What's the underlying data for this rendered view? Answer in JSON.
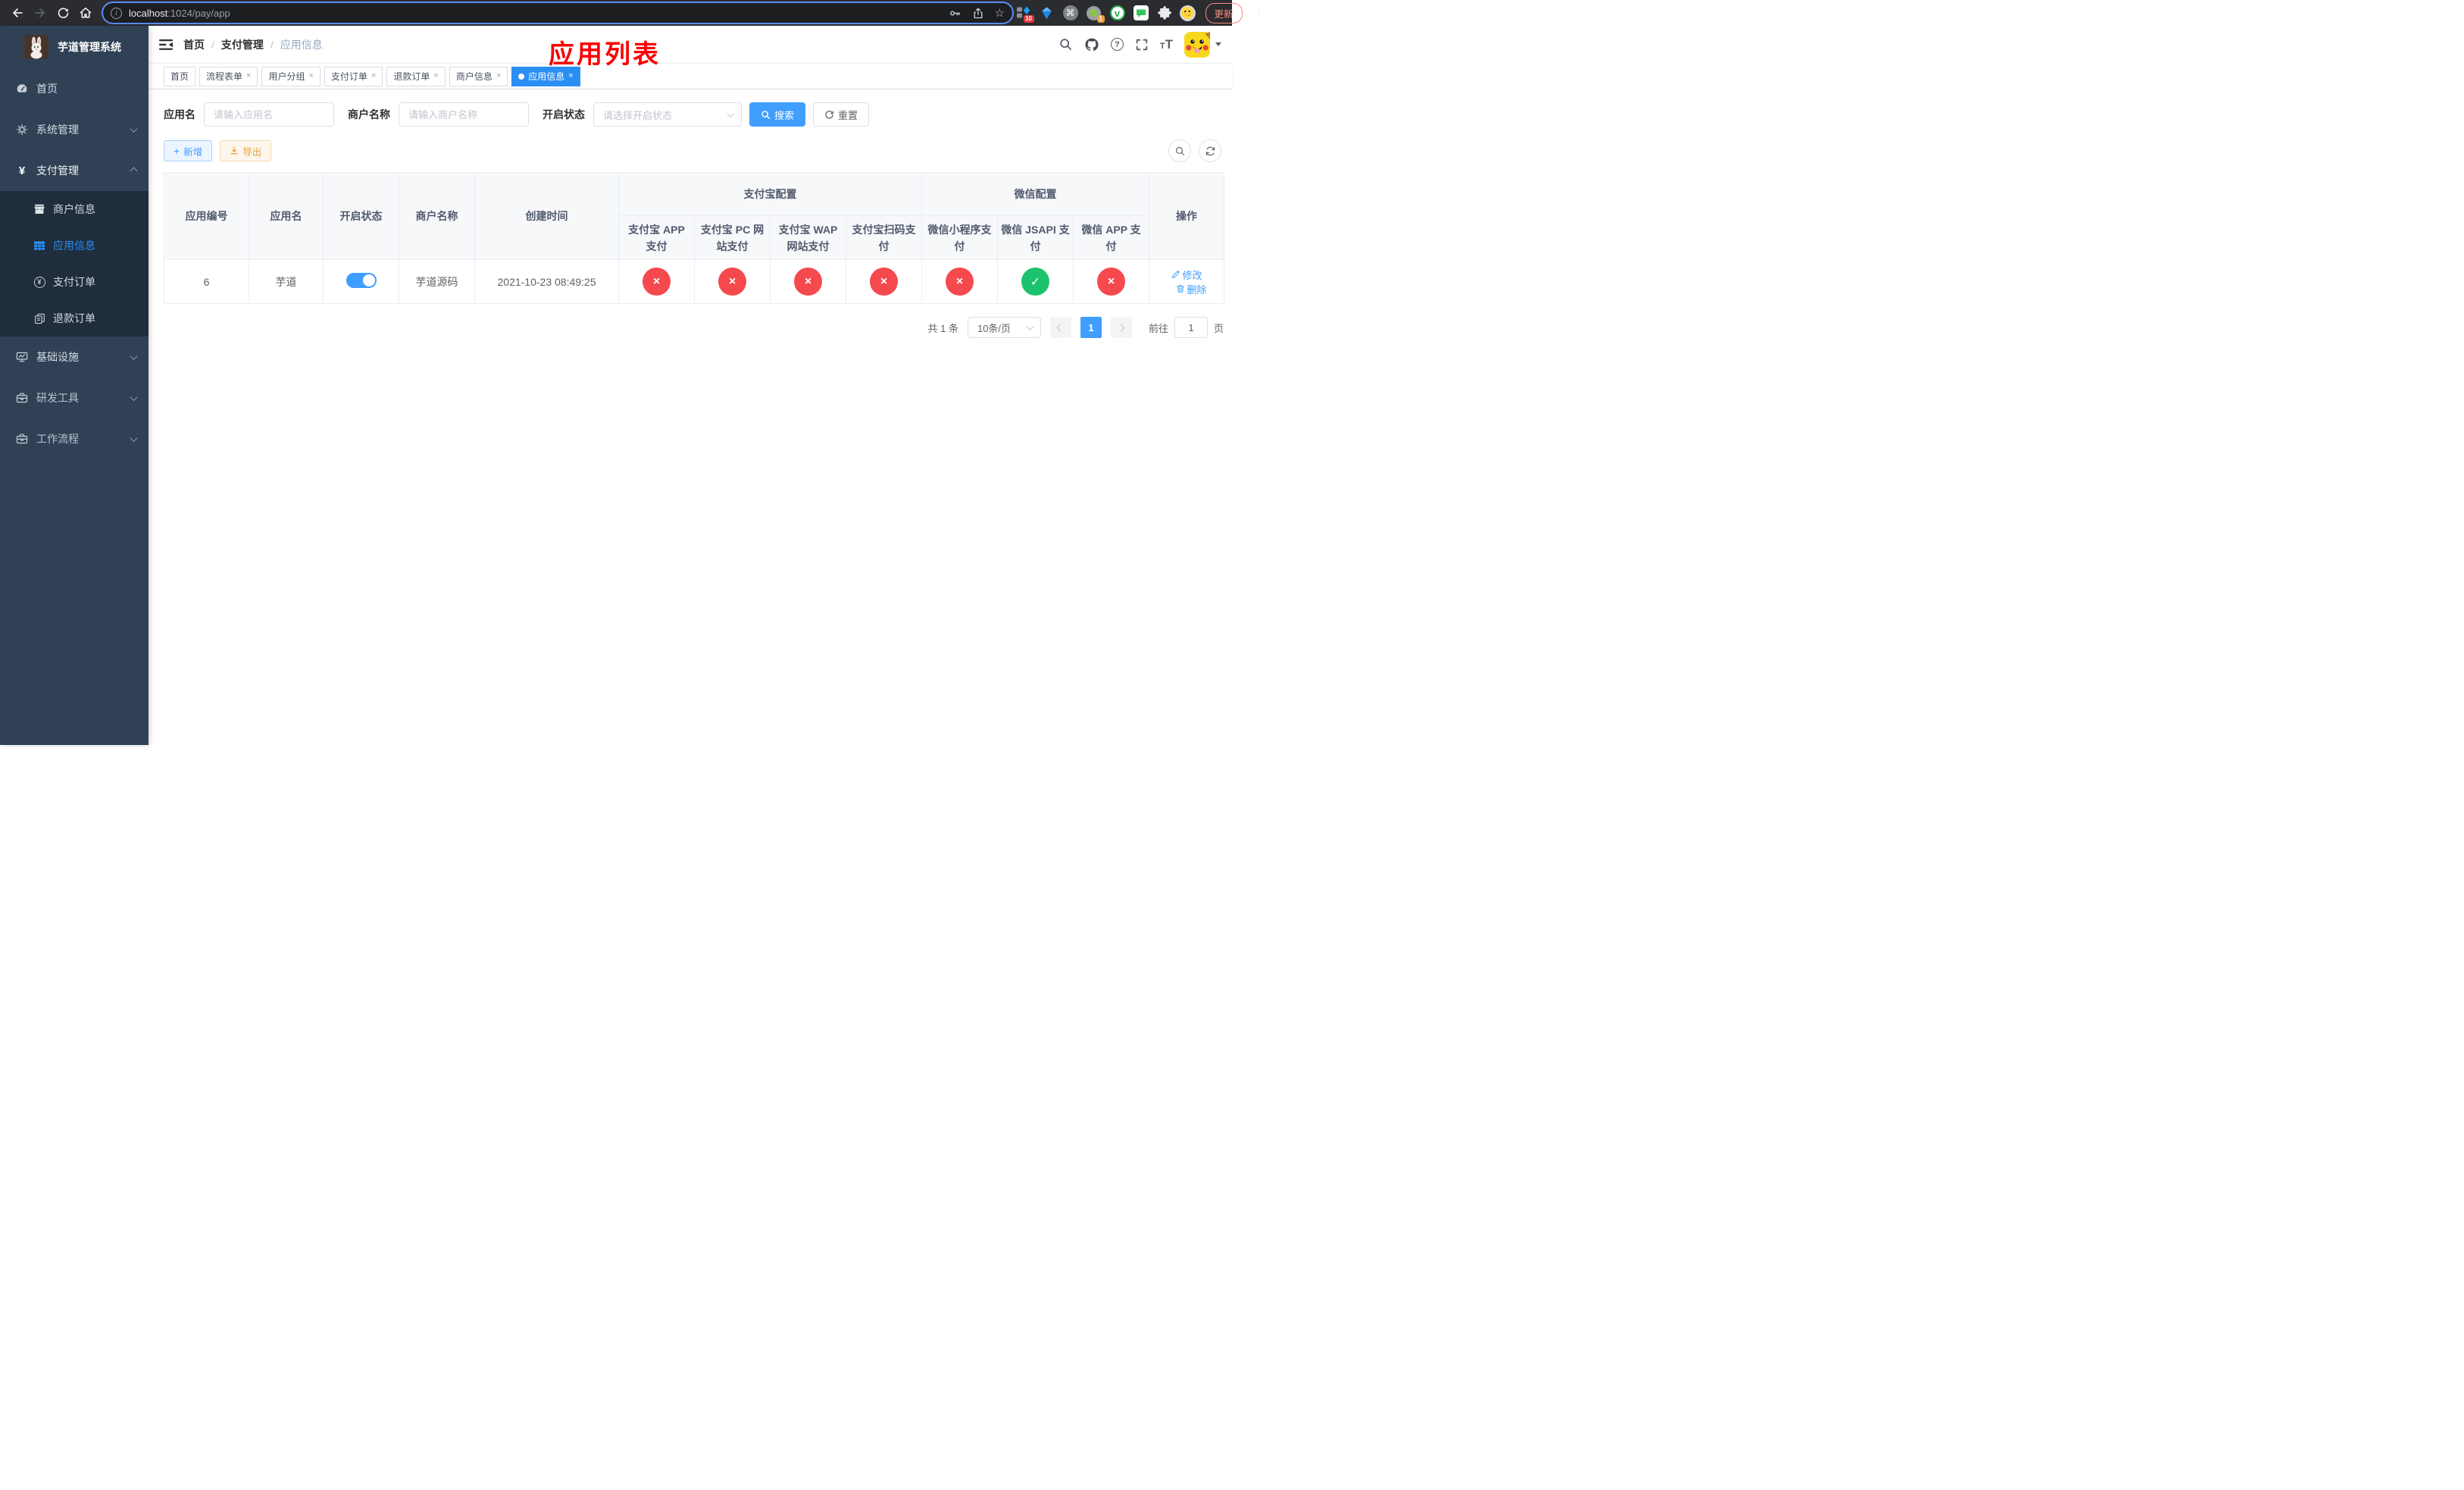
{
  "colors": {
    "accent_blue": "#409eff",
    "active_tab_blue": "#2a8ef5",
    "success_green": "#1dc26d",
    "danger_red": "#f5494d",
    "warning_orange": "#e6a23c",
    "annotation_red": "#fa0000",
    "sidebar_bg": "#304156",
    "submenu_bg": "#1f2d3d",
    "update_pill_red": "#f28b82"
  },
  "icons": {
    "info": "i",
    "star": "☆",
    "command": "⌘",
    "vue_letter": "v",
    "overflow_menu": "⋮",
    "yuan": "¥",
    "plus": "+",
    "tab_close": "×",
    "status_disabled": "×",
    "status_enabled": "✓",
    "help": "?",
    "font_size": "TT"
  },
  "browser": {
    "url_host": "localhost",
    "url_path": ":1024/pay/app",
    "update_label": "更新",
    "ext_badge_password": "10",
    "ext_badge_proxy": "1"
  },
  "annotation": {
    "title": "应用列表"
  },
  "sidebar": {
    "app_title": "芋道管理系统",
    "menu": [
      {
        "label": "首页"
      },
      {
        "label": "系统管理"
      },
      {
        "label": "支付管理"
      },
      {
        "label": "基础设施"
      },
      {
        "label": "研发工具"
      },
      {
        "label": "工作流程"
      }
    ],
    "submenu": [
      {
        "label": "商户信息",
        "state": "normal"
      },
      {
        "label": "应用信息",
        "state": "active"
      },
      {
        "label": "支付订单",
        "state": "normal"
      },
      {
        "label": "退款订单",
        "state": "normal"
      }
    ]
  },
  "navbar": {
    "breadcrumb": [
      "首页",
      "支付管理",
      "应用信息"
    ],
    "separator": "/"
  },
  "tabbar": {
    "tabs": [
      {
        "label": "首页",
        "state": "normal"
      },
      {
        "label": "流程表单",
        "state": "normal"
      },
      {
        "label": "用户分组",
        "state": "normal"
      },
      {
        "label": "支付订单",
        "state": "normal"
      },
      {
        "label": "退款订单",
        "state": "normal"
      },
      {
        "label": "商户信息",
        "state": "normal"
      },
      {
        "label": "应用信息",
        "state": "active"
      }
    ]
  },
  "filters": {
    "app_name": {
      "label": "应用名",
      "placeholder": "请输入应用名"
    },
    "merchant_name": {
      "label": "商户名称",
      "placeholder": "请输入商户名称"
    },
    "status": {
      "label": "开启状态",
      "placeholder": "请选择开启状态"
    },
    "search_label": "搜索",
    "reset_label": "重置"
  },
  "toolbar": {
    "add_label": "新增",
    "export_label": "导出"
  },
  "table": {
    "headers": {
      "app_id": "应用编号",
      "app_name": "应用名",
      "enabled": "开启状态",
      "merchant_name": "商户名称",
      "create_time": "创建时间",
      "alipay_group": "支付宝配置",
      "wechat_group": "微信配置",
      "alipay_app": "支付宝 APP 支付",
      "alipay_pc": "支付宝 PC 网站支付",
      "alipay_wap": "支付宝 WAP 网站支付",
      "alipay_qr": "支付宝扫码支付",
      "wechat_lite": "微信小程序支付",
      "wechat_jsapi": "微信 JSAPI 支付",
      "wechat_app": "微信 APP 支付",
      "actions": "操作"
    },
    "rows": [
      {
        "app_id": "6",
        "app_name": "芋道",
        "enabled": "on",
        "merchant_name": "芋道源码",
        "create_time": "2021-10-23 08:49:25",
        "statuses": [
          "no",
          "no",
          "no",
          "no",
          "no",
          "yes",
          "no"
        ],
        "edit_label": "修改",
        "delete_label": "删除"
      }
    ]
  },
  "pagination": {
    "total": "共 1 条",
    "page_size": "10条/页",
    "page": "1",
    "goto_label": "前往",
    "goto_value": "1",
    "unit_label": "页"
  }
}
